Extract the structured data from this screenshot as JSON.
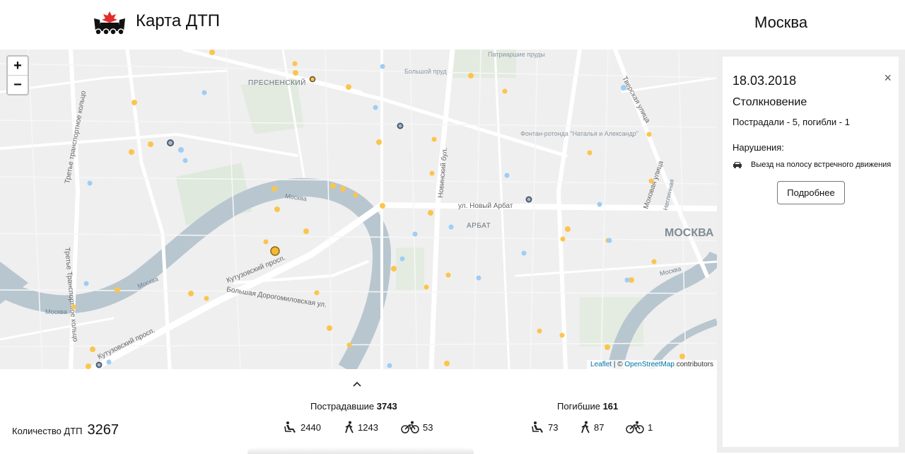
{
  "header": {
    "title": "Карта ДТП",
    "city": "Москва"
  },
  "map": {
    "labels": {
      "presnensky": "ПРЕСНЕНСКИЙ",
      "arbat": "АРБАТ",
      "moskva": "МОСКВА",
      "novy_arbat": "ул. Новый Арбат",
      "kutuzovsky": "Кутузовский просп.",
      "kutuzovsky2": "Кутузовский просп.",
      "dorogomilovskaya": "Большая Дорогомиловская ул.",
      "ttk": "Третье транспортное кольцо",
      "ttk2": "Третье Транспортное кольцо",
      "novinsky": "Новинский бул.",
      "mokhovaya": "Моховая улица",
      "tverskaya": "Тверская улица",
      "patriarshie": "Патриаршие пруды",
      "bolshoy_prud": "Большой пруд",
      "fontan": "Фонтан-ротонда \"Наталья и Александр\"",
      "moskva_river": "Москва",
      "moskva_river2": "Москва",
      "moskva_river3": "Москва",
      "moskva_river4": "Москва",
      "neglinnaya": "Неглинная"
    },
    "zoom_in": "+",
    "zoom_out": "−",
    "attribution": {
      "leaflet": "Leaflet",
      "sep": " | © ",
      "osm": "OpenStreetMap",
      "suffix": " contributors"
    },
    "marker_colors": {
      "injured": "#fbc54d",
      "pedestrian": "#9ecdf5",
      "fatal": "#5b6e8a"
    }
  },
  "details": {
    "date": "18.03.2018",
    "close": "×",
    "type": "Столкновение",
    "victims": "Пострадали - 5, погибли - 1",
    "violations_title": "Нарушения:",
    "violation": "Выезд на полосу встречного движения",
    "violation_icon": "car-icon",
    "more_button": "Подробнее"
  },
  "stats": {
    "count_label": "Количество ДТП",
    "count": "3267",
    "injured_label": "Пострадавшие",
    "injured_total": "3743",
    "injured_drivers": "2440",
    "injured_pedestrians": "1243",
    "injured_cyclists": "53",
    "killed_label": "Погибшие",
    "killed_total": "161",
    "killed_drivers": "73",
    "killed_pedestrians": "87",
    "killed_cyclists": "1"
  }
}
